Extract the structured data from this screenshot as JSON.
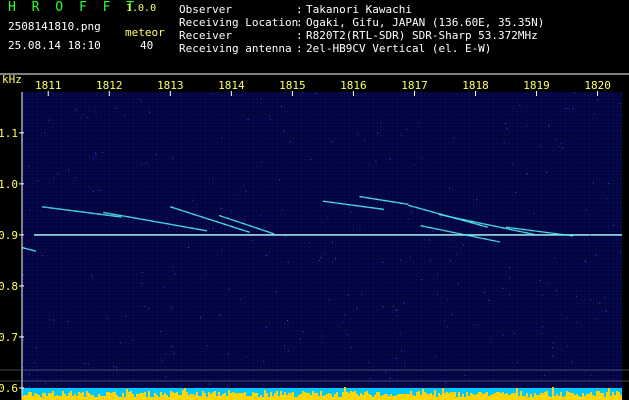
{
  "header": {
    "app_title": "H R O F F T",
    "app_version": "1.0.0",
    "file_name": "2508141810.png",
    "timestamp": "25.08.14 18:10",
    "meteor_label": "meteor",
    "meteor_count": "40"
  },
  "info": [
    {
      "label": "Observer",
      "value": "Takanori Kawachi"
    },
    {
      "label": "Receiving Location",
      "value": "Ogaki, Gifu, JAPAN (136.60E, 35.35N)"
    },
    {
      "label": "Receiver",
      "value": "R820T2(RTL-SDR) SDR-Sharp 53.372MHz"
    },
    {
      "label": "Receiving antenna",
      "value": "2el-HB9CV Vertical (el. E-W)"
    }
  ],
  "colors": {
    "background": "#000000",
    "plot_background": "#03033d",
    "header_green": "#2bff2b",
    "axis_yellow": "#ffff66",
    "carrier_line": "#8cf0ff",
    "bottom_strip": "#00c8ff",
    "signal_peak": "#ffd700"
  },
  "chart_data": {
    "type": "heatmap",
    "title": "",
    "xlabel": "",
    "ylabel": "kHz",
    "x_ticks": [
      "1811",
      "1812",
      "1813",
      "1814",
      "1815",
      "1816",
      "1817",
      "1818",
      "1819",
      "1820"
    ],
    "y_ticks": [
      "1.1",
      "1.0",
      "0.9",
      "0.8",
      "0.7",
      "0.6"
    ],
    "xlim": [
      1810.57,
      1820.4
    ],
    "ylim": [
      0.6,
      1.18
    ],
    "carrier_khz": 0.9,
    "meteor_echo_count": 40,
    "grid": false,
    "echo_traces": [
      {
        "x": [
          1810.9,
          1812.2
        ],
        "y": [
          0.955,
          0.935
        ]
      },
      {
        "x": [
          1811.9,
          1813.6
        ],
        "y": [
          0.944,
          0.908
        ]
      },
      {
        "x": [
          1813.0,
          1814.3
        ],
        "y": [
          0.955,
          0.905
        ]
      },
      {
        "x": [
          1813.8,
          1814.7
        ],
        "y": [
          0.938,
          0.902
        ]
      },
      {
        "x": [
          1815.5,
          1816.5
        ],
        "y": [
          0.966,
          0.95
        ]
      },
      {
        "x": [
          1816.1,
          1816.9
        ],
        "y": [
          0.975,
          0.96
        ]
      },
      {
        "x": [
          1816.9,
          1818.2
        ],
        "y": [
          0.958,
          0.915
        ]
      },
      {
        "x": [
          1817.4,
          1819.0
        ],
        "y": [
          0.94,
          0.9
        ]
      },
      {
        "x": [
          1817.1,
          1818.4
        ],
        "y": [
          0.918,
          0.886
        ]
      },
      {
        "x": [
          1818.5,
          1819.6
        ],
        "y": [
          0.915,
          0.898
        ]
      },
      {
        "x": [
          1810.58,
          1810.8
        ],
        "y": [
          0.875,
          0.868
        ]
      }
    ]
  }
}
